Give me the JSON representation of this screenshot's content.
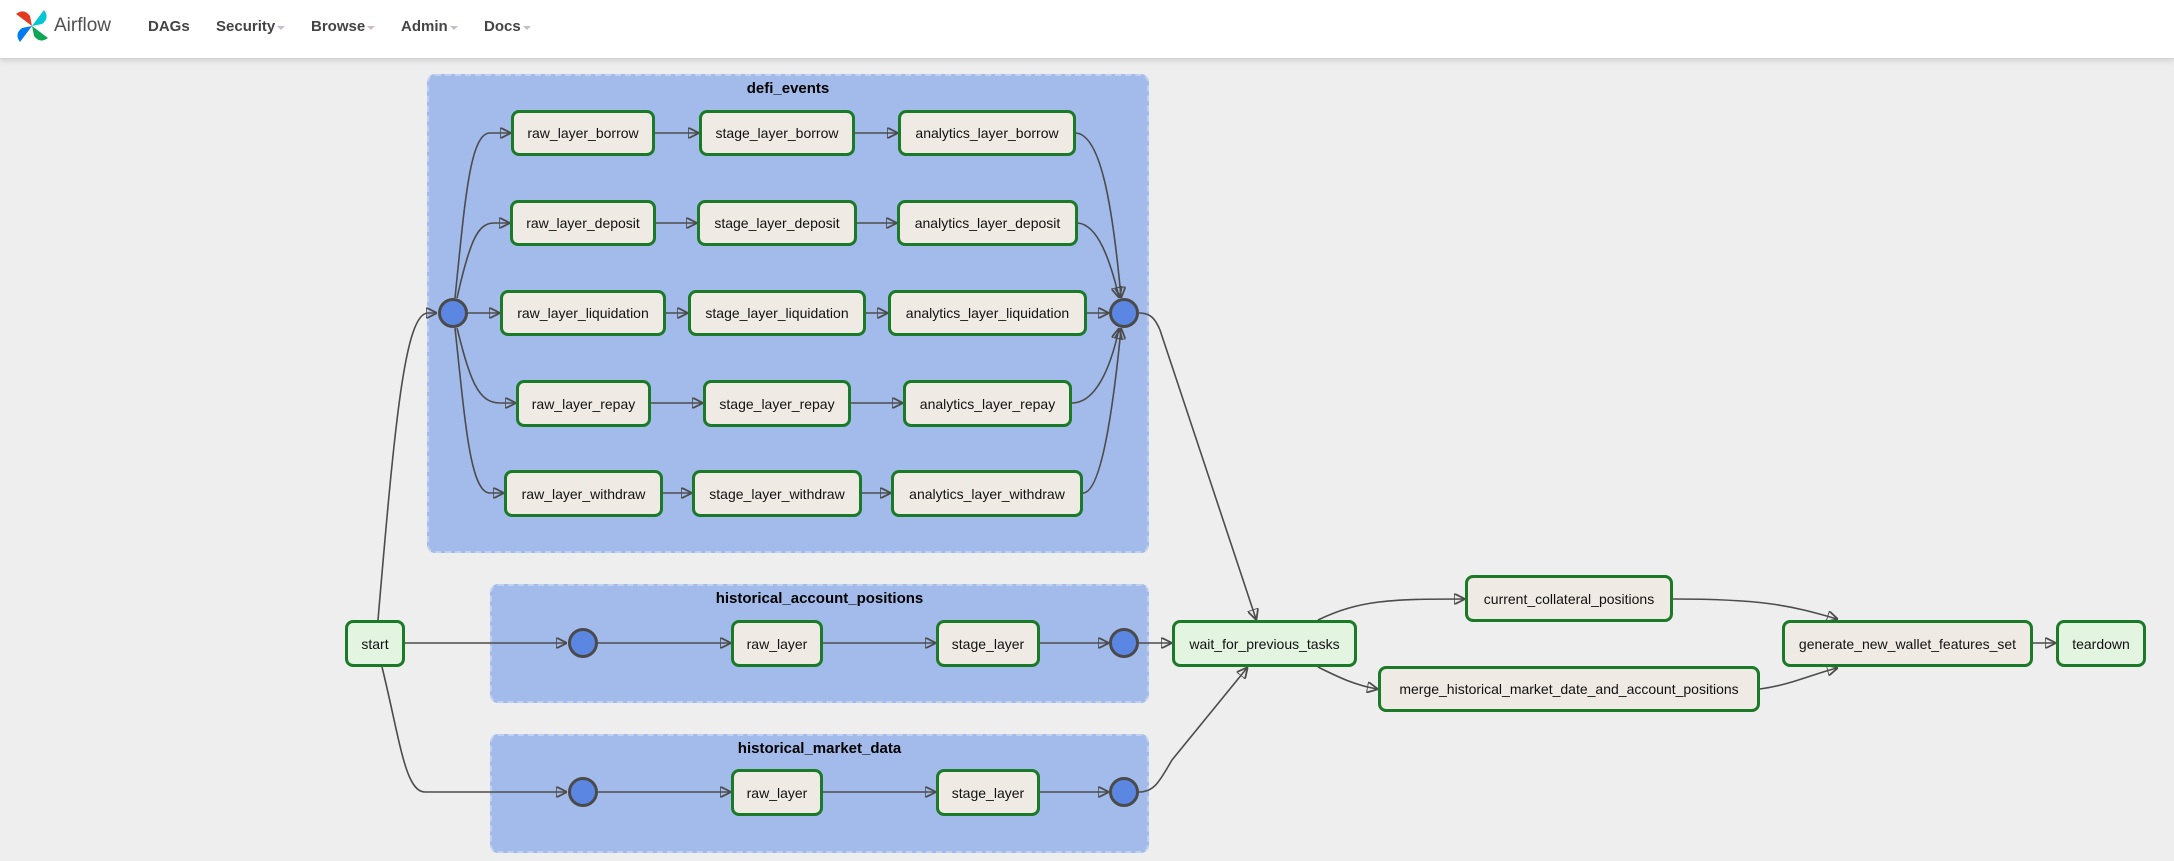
{
  "navbar": {
    "brand": "Airflow",
    "items": [
      {
        "label": "DAGs",
        "dropdown": false
      },
      {
        "label": "Security",
        "dropdown": true
      },
      {
        "label": "Browse",
        "dropdown": true
      },
      {
        "label": "Admin",
        "dropdown": true
      },
      {
        "label": "Docs",
        "dropdown": true
      }
    ]
  },
  "graph": {
    "groups": {
      "defi_events": "defi_events",
      "historical_account_positions": "historical_account_positions",
      "historical_market_data": "historical_market_data"
    },
    "tasks": {
      "start": "start",
      "raw_layer_borrow": "raw_layer_borrow",
      "stage_layer_borrow": "stage_layer_borrow",
      "analytics_layer_borrow": "analytics_layer_borrow",
      "raw_layer_deposit": "raw_layer_deposit",
      "stage_layer_deposit": "stage_layer_deposit",
      "analytics_layer_deposit": "analytics_layer_deposit",
      "raw_layer_liquidation": "raw_layer_liquidation",
      "stage_layer_liquidation": "stage_layer_liquidation",
      "analytics_layer_liquidation": "analytics_layer_liquidation",
      "raw_layer_repay": "raw_layer_repay",
      "stage_layer_repay": "stage_layer_repay",
      "analytics_layer_repay": "analytics_layer_repay",
      "raw_layer_withdraw": "raw_layer_withdraw",
      "stage_layer_withdraw": "stage_layer_withdraw",
      "analytics_layer_withdraw": "analytics_layer_withdraw",
      "hap_raw_layer": "raw_layer",
      "hap_stage_layer": "stage_layer",
      "hmd_raw_layer": "raw_layer",
      "hmd_stage_layer": "stage_layer",
      "wait_for_previous_tasks": "wait_for_previous_tasks",
      "current_collateral_positions": "current_collateral_positions",
      "merge": "merge_historical_market_date_and_account_positions",
      "generate_new_wallet_features_set": "generate_new_wallet_features_set",
      "teardown": "teardown"
    },
    "colors": {
      "group_bg": "#a2bbea",
      "task_border": "#1b7a27",
      "task_bg": "#efebe4",
      "task_bg_success_light": "#e3f4e1",
      "join_node": "#5b87e2",
      "edge": "#4c4c4c"
    }
  }
}
